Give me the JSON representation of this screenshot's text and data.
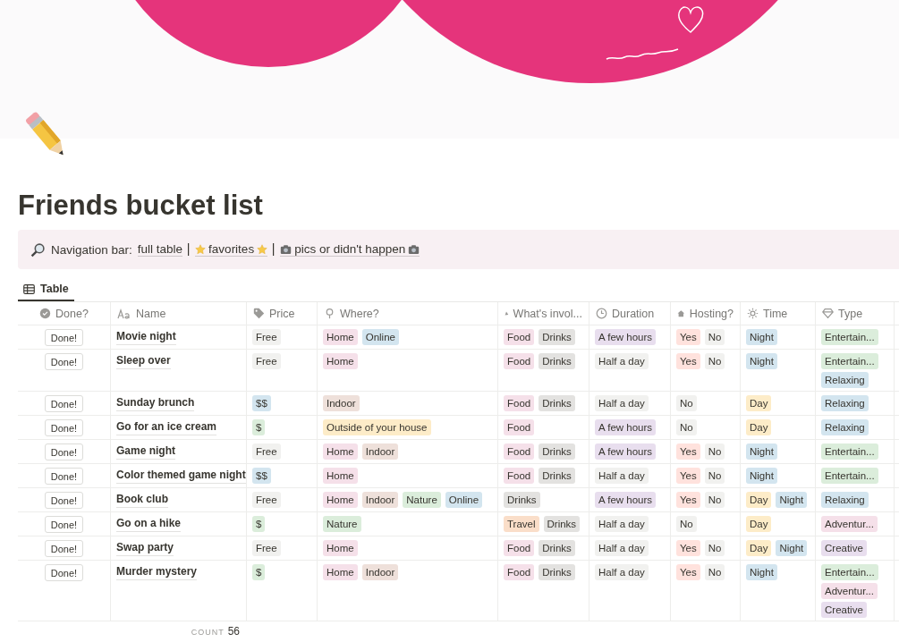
{
  "page": {
    "title": "Friends bucket list"
  },
  "callout": {
    "label": "Navigation bar:",
    "links": [
      {
        "text": "full table",
        "kind": "plain"
      },
      {
        "text": "favorites",
        "kind": "star"
      },
      {
        "text": "pics or didn't happen",
        "kind": "camera"
      }
    ]
  },
  "views": [
    {
      "label": "Table",
      "selected": true
    }
  ],
  "table": {
    "columns": [
      "Done?",
      "Name",
      "Price",
      "Where?",
      "What's invol...",
      "Duration",
      "Hosting?",
      "Time",
      "Type"
    ],
    "rows": [
      {
        "button": "Done!",
        "name": "Movie night",
        "tags": [
          [
            {
              "text": "Free",
              "color": "#f1f1ef"
            }
          ],
          [
            {
              "text": "Home",
              "color": "#f5e0e9"
            },
            {
              "text": "Online",
              "color": "#d3e5ef"
            }
          ],
          [
            {
              "text": "Food",
              "color": "#f5e0e9"
            },
            {
              "text": "Drinks",
              "color": "#e3e2e0"
            }
          ],
          [
            {
              "text": "A few hours",
              "color": "#e8deee"
            }
          ],
          [
            {
              "text": "Yes",
              "color": "#ffe2dd"
            },
            {
              "text": "No",
              "color": "#f1f1ef"
            }
          ],
          [
            {
              "text": "Night",
              "color": "#d3e5ef"
            }
          ],
          [
            {
              "text": "Entertain...",
              "color": "#dbeddb"
            }
          ]
        ]
      },
      {
        "button": "Done!",
        "name": "Sleep over",
        "tags": [
          [
            {
              "text": "Free",
              "color": "#f1f1ef"
            }
          ],
          [
            {
              "text": "Home",
              "color": "#f5e0e9"
            }
          ],
          [
            {
              "text": "Food",
              "color": "#f5e0e9"
            },
            {
              "text": "Drinks",
              "color": "#e3e2e0"
            }
          ],
          [
            {
              "text": "Half a day",
              "color": "#f1f1ef"
            }
          ],
          [
            {
              "text": "Yes",
              "color": "#ffe2dd"
            },
            {
              "text": "No",
              "color": "#f1f1ef"
            }
          ],
          [
            {
              "text": "Night",
              "color": "#d3e5ef"
            }
          ],
          [
            {
              "text": "Entertain...",
              "color": "#dbeddb"
            },
            {
              "text": "Relaxing",
              "color": "#d3e5ef"
            }
          ]
        ]
      },
      {
        "button": "Done!",
        "name": "Sunday brunch",
        "tags": [
          [
            {
              "text": "$$",
              "color": "#d3e5ef"
            }
          ],
          [
            {
              "text": "Indoor",
              "color": "#eee0da"
            }
          ],
          [
            {
              "text": "Food",
              "color": "#f5e0e9"
            },
            {
              "text": "Drinks",
              "color": "#e3e2e0"
            }
          ],
          [
            {
              "text": "Half a day",
              "color": "#f1f1ef"
            }
          ],
          [
            {
              "text": "No",
              "color": "#f1f1ef"
            }
          ],
          [
            {
              "text": "Day",
              "color": "#fdecc8"
            }
          ],
          [
            {
              "text": "Relaxing",
              "color": "#d3e5ef"
            }
          ]
        ]
      },
      {
        "button": "Done!",
        "name": "Go for an ice cream",
        "tags": [
          [
            {
              "text": "$",
              "color": "#dbeddb"
            }
          ],
          [
            {
              "text": "Outside of your house",
              "color": "#fdecc8"
            }
          ],
          [
            {
              "text": "Food",
              "color": "#f5e0e9"
            }
          ],
          [
            {
              "text": "A few hours",
              "color": "#e8deee"
            }
          ],
          [
            {
              "text": "No",
              "color": "#f1f1ef"
            }
          ],
          [
            {
              "text": "Day",
              "color": "#fdecc8"
            }
          ],
          [
            {
              "text": "Relaxing",
              "color": "#d3e5ef"
            }
          ]
        ]
      },
      {
        "button": "Done!",
        "name": "Game night",
        "tags": [
          [
            {
              "text": "Free",
              "color": "#f1f1ef"
            }
          ],
          [
            {
              "text": "Home",
              "color": "#f5e0e9"
            },
            {
              "text": "Indoor",
              "color": "#eee0da"
            }
          ],
          [
            {
              "text": "Food",
              "color": "#f5e0e9"
            },
            {
              "text": "Drinks",
              "color": "#e3e2e0"
            }
          ],
          [
            {
              "text": "A few hours",
              "color": "#e8deee"
            }
          ],
          [
            {
              "text": "Yes",
              "color": "#ffe2dd"
            },
            {
              "text": "No",
              "color": "#f1f1ef"
            }
          ],
          [
            {
              "text": "Night",
              "color": "#d3e5ef"
            }
          ],
          [
            {
              "text": "Entertain...",
              "color": "#dbeddb"
            }
          ]
        ]
      },
      {
        "button": "Done!",
        "name": "Color themed game night",
        "tags": [
          [
            {
              "text": "$$",
              "color": "#d3e5ef"
            }
          ],
          [
            {
              "text": "Home",
              "color": "#f5e0e9"
            }
          ],
          [
            {
              "text": "Food",
              "color": "#f5e0e9"
            },
            {
              "text": "Drinks",
              "color": "#e3e2e0"
            }
          ],
          [
            {
              "text": "Half a day",
              "color": "#f1f1ef"
            }
          ],
          [
            {
              "text": "Yes",
              "color": "#ffe2dd"
            },
            {
              "text": "No",
              "color": "#f1f1ef"
            }
          ],
          [
            {
              "text": "Night",
              "color": "#d3e5ef"
            }
          ],
          [
            {
              "text": "Entertain...",
              "color": "#dbeddb"
            }
          ]
        ]
      },
      {
        "button": "Done!",
        "name": "Book club",
        "tags": [
          [
            {
              "text": "Free",
              "color": "#f1f1ef"
            }
          ],
          [
            {
              "text": "Home",
              "color": "#f5e0e9"
            },
            {
              "text": "Indoor",
              "color": "#eee0da"
            },
            {
              "text": "Nature",
              "color": "#dbeddb"
            },
            {
              "text": "Online",
              "color": "#d3e5ef"
            }
          ],
          [
            {
              "text": "Drinks",
              "color": "#e3e2e0"
            }
          ],
          [
            {
              "text": "A few hours",
              "color": "#e8deee"
            }
          ],
          [
            {
              "text": "Yes",
              "color": "#ffe2dd"
            },
            {
              "text": "No",
              "color": "#f1f1ef"
            }
          ],
          [
            {
              "text": "Day",
              "color": "#fdecc8"
            },
            {
              "text": "Night",
              "color": "#d3e5ef"
            }
          ],
          [
            {
              "text": "Relaxing",
              "color": "#d3e5ef"
            }
          ]
        ]
      },
      {
        "button": "Done!",
        "name": "Go on a hike",
        "tags": [
          [
            {
              "text": "$",
              "color": "#dbeddb"
            }
          ],
          [
            {
              "text": "Nature",
              "color": "#dbeddb"
            }
          ],
          [
            {
              "text": "Travel",
              "color": "#fadec9"
            },
            {
              "text": "Drinks",
              "color": "#e3e2e0"
            }
          ],
          [
            {
              "text": "Half a day",
              "color": "#f1f1ef"
            }
          ],
          [
            {
              "text": "No",
              "color": "#f1f1ef"
            }
          ],
          [
            {
              "text": "Day",
              "color": "#fdecc8"
            }
          ],
          [
            {
              "text": "Adventur...",
              "color": "#f5e0e9"
            }
          ]
        ]
      },
      {
        "button": "Done!",
        "name": "Swap party",
        "tags": [
          [
            {
              "text": "Free",
              "color": "#f1f1ef"
            }
          ],
          [
            {
              "text": "Home",
              "color": "#f5e0e9"
            }
          ],
          [
            {
              "text": "Food",
              "color": "#f5e0e9"
            },
            {
              "text": "Drinks",
              "color": "#e3e2e0"
            }
          ],
          [
            {
              "text": "Half a day",
              "color": "#f1f1ef"
            }
          ],
          [
            {
              "text": "Yes",
              "color": "#ffe2dd"
            },
            {
              "text": "No",
              "color": "#f1f1ef"
            }
          ],
          [
            {
              "text": "Day",
              "color": "#fdecc8"
            },
            {
              "text": "Night",
              "color": "#d3e5ef"
            }
          ],
          [
            {
              "text": "Creative",
              "color": "#e8deee"
            }
          ]
        ]
      },
      {
        "button": "Done!",
        "name": "Murder mystery",
        "tags": [
          [
            {
              "text": "$",
              "color": "#dbeddb"
            }
          ],
          [
            {
              "text": "Home",
              "color": "#f5e0e9"
            },
            {
              "text": "Indoor",
              "color": "#eee0da"
            }
          ],
          [
            {
              "text": "Food",
              "color": "#f5e0e9"
            },
            {
              "text": "Drinks",
              "color": "#e3e2e0"
            }
          ],
          [
            {
              "text": "Half a day",
              "color": "#f1f1ef"
            }
          ],
          [
            {
              "text": "Yes",
              "color": "#ffe2dd"
            },
            {
              "text": "No",
              "color": "#f1f1ef"
            }
          ],
          [
            {
              "text": "Night",
              "color": "#d3e5ef"
            }
          ],
          [
            {
              "text": "Entertain...",
              "color": "#dbeddb"
            },
            {
              "text": "Adventur...",
              "color": "#f5e0e9"
            },
            {
              "text": "Creative",
              "color": "#e8deee"
            }
          ]
        ]
      }
    ]
  },
  "footer": {
    "label": "COUNT",
    "value": "56"
  }
}
